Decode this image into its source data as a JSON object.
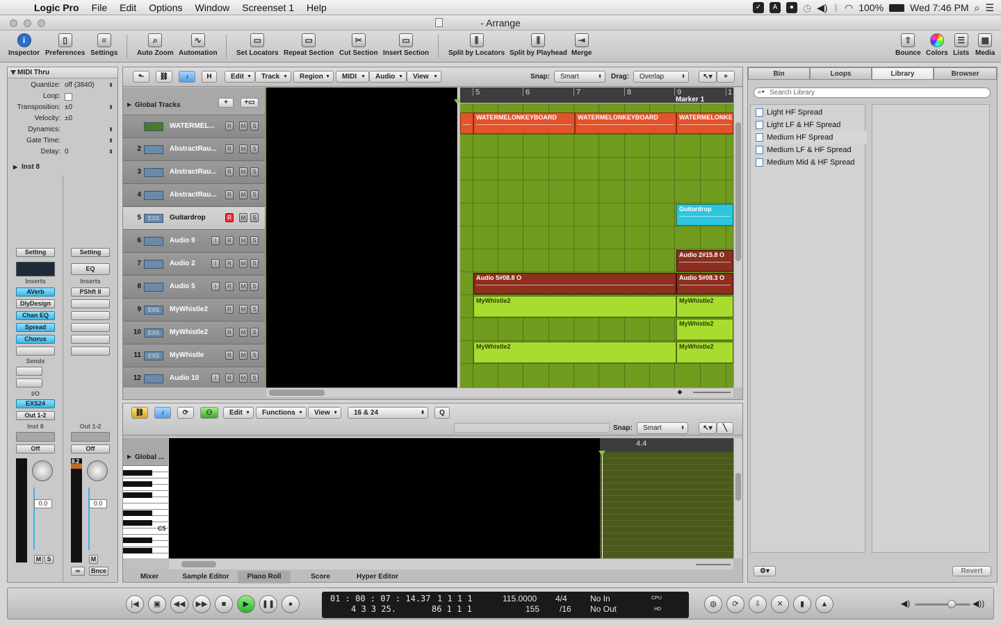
{
  "menubar": {
    "app": "Logic Pro",
    "items": [
      "File",
      "Edit",
      "Options",
      "Window",
      "Screenset 1",
      "Help"
    ],
    "battery": "100%",
    "clock": "Wed 7:46 PM"
  },
  "window": {
    "title": "- Arrange"
  },
  "toolbar": {
    "buttons": [
      "Inspector",
      "Preferences",
      "Settings",
      "Auto Zoom",
      "Automation",
      "Set Locators",
      "Repeat Section",
      "Cut Section",
      "Insert Section",
      "Split by Locators",
      "Split by Playhead",
      "Merge",
      "Bounce",
      "Colors",
      "Lists",
      "Media"
    ]
  },
  "inspector": {
    "title": "MIDI Thru",
    "params": [
      {
        "label": "Quantize:",
        "value": "off (3840)"
      },
      {
        "label": "Loop:",
        "value": ""
      },
      {
        "label": "Transposition:",
        "value": "±0"
      },
      {
        "label": "Velocity:",
        "value": "±0"
      },
      {
        "label": "Dynamics:",
        "value": ""
      },
      {
        "label": "Gate Time:",
        "value": ""
      },
      {
        "label": "Delay:",
        "value": "0"
      }
    ],
    "instrument_header": "Inst 8",
    "strip1": {
      "setting": "Setting",
      "inserts_label": "Inserts",
      "inserts": [
        "AVerb",
        "DlyDesign",
        "Chan EQ",
        "Spread",
        "Chorus"
      ],
      "sends_label": "Sends",
      "io_label": "I/O",
      "input": "EXS24",
      "output": "Out 1-2",
      "name": "Inst 8",
      "automation": "Off",
      "fader_value": "0.0",
      "mute": "M",
      "solo": "S"
    },
    "strip2": {
      "setting": "Setting",
      "eq": "EQ",
      "inserts_label": "Inserts",
      "inserts": [
        "PShft II"
      ],
      "name": "Out 1-2",
      "automation": "Off",
      "fader_value": "0.0",
      "peak": "8.2",
      "mute": "M",
      "bounce": "Bnce"
    }
  },
  "arrange": {
    "menus": [
      "Edit",
      "Track",
      "Region",
      "MIDI",
      "Audio",
      "View"
    ],
    "snap_label": "Snap:",
    "snap_value": "Smart",
    "drag_label": "Drag:",
    "drag_value": "Overlap",
    "h_button": "H",
    "global_tracks": "Global Tracks",
    "ruler": [
      "5",
      "6",
      "7",
      "8",
      "9",
      "1"
    ],
    "marker": "Marker 1",
    "tracks": [
      {
        "num": "",
        "icon": "",
        "name": "WATERMEL..."
      },
      {
        "num": "2",
        "icon": "",
        "name": "AbstractRau..."
      },
      {
        "num": "3",
        "icon": "",
        "name": "AbstractRau..."
      },
      {
        "num": "4",
        "icon": "",
        "name": "AbstractRau..."
      },
      {
        "num": "5",
        "icon": "EXS",
        "name": "Guitardrop"
      },
      {
        "num": "6",
        "icon": "",
        "name": "Audio 9"
      },
      {
        "num": "7",
        "icon": "",
        "name": "Audio 2"
      },
      {
        "num": "8",
        "icon": "",
        "name": "Audio 5"
      },
      {
        "num": "9",
        "icon": "EXS",
        "name": "MyWhistle2"
      },
      {
        "num": "10",
        "icon": "EXS",
        "name": "MyWhistle2"
      },
      {
        "num": "11",
        "icon": "EXS",
        "name": "MyWhistle"
      },
      {
        "num": "12",
        "icon": "",
        "name": "Audio 10"
      }
    ],
    "btn_r": "R",
    "btn_m": "M",
    "btn_s": "S",
    "btn_i": "I",
    "regions": [
      {
        "label": "WATERMELONKEYBOARD"
      },
      {
        "label": "WATERMELONKEYBOARD"
      },
      {
        "label": "WATERMELONKE"
      },
      {
        "label": "Guitardrop"
      },
      {
        "label": "Audio 2#15.8 O"
      },
      {
        "label": "Audio 5#08.8 O"
      },
      {
        "label": "Audio 5#08.3 O"
      },
      {
        "label": "MyWhistle2"
      },
      {
        "label": "MyWhistle2"
      },
      {
        "label": "MyWhistle2"
      },
      {
        "label": "MyWhistle2"
      },
      {
        "label": "MyWhistle2"
      }
    ]
  },
  "editor": {
    "menus": [
      "Edit",
      "Functions",
      "View"
    ],
    "quantize": "16 & 24",
    "q_button": "Q",
    "snap_label": "Snap:",
    "snap_value": "Smart",
    "global": "Global ...",
    "ruler_label": "4.4",
    "key_label": "C5",
    "tabs": [
      "Mixer",
      "Sample Editor",
      "Piano Roll",
      "Score",
      "Hyper Editor"
    ]
  },
  "library": {
    "tabs": [
      "Bin",
      "Loops",
      "Library",
      "Browser"
    ],
    "search_placeholder": "Search Library",
    "items": [
      "Light HF Spread",
      "Light LF & HF Spread",
      "Medium HF Spread",
      "Medium LF & HF Spread",
      "Medium Mid & HF Spread"
    ],
    "revert": "Revert"
  },
  "transport": {
    "smpte_top": "01 : 00 : 07 : 14.37",
    "smpte_bottom": "4    3    3    25.",
    "bars_top": "1     1     1     1",
    "bars_bottom": "86    1     1     1",
    "tempo": "115.0000",
    "tempo2": "155",
    "sig": "4/4",
    "div": "/16",
    "in": "No In",
    "out": "No Out",
    "cpu": "CPU",
    "hd": "HD"
  },
  "colors": {
    "accent": "#3cb5e6",
    "lane": "#6f9b1e",
    "region_orange": "#e2532c",
    "region_cyan": "#2cc7de"
  }
}
